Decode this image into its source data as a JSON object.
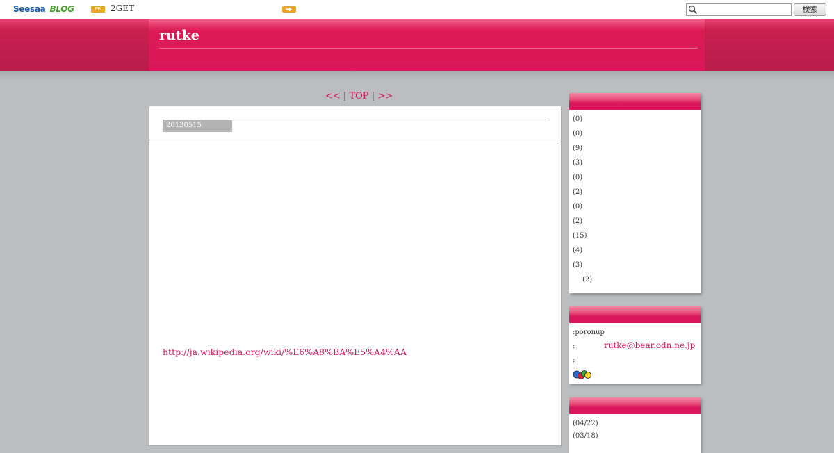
{
  "topbar": {
    "logo_seesaa": "Seesaa",
    "logo_blog": "BLOG",
    "pr_badge": "PR",
    "pr_text": "2GET",
    "search_placeholder": "",
    "search_button": "検索"
  },
  "header": {
    "title": "rutke"
  },
  "nav": {
    "prev": "<<",
    "sep1": " | ",
    "top": "TOP",
    "sep2": " | ",
    "next": ">>"
  },
  "article": {
    "date": "20130515",
    "link": "http://ja.wikipedia.org/wiki/%E6%A8%BA%E5%A4%AA"
  },
  "sidebar": {
    "categories": [
      "(0)",
      "(0)",
      "(9)",
      "(3)",
      "(0)",
      "(2)",
      "(0)",
      "(2)",
      "(15)",
      "(4)",
      "(3)",
      "(2)"
    ],
    "profile": {
      "name": ":poronup",
      "mail_prefix": ":",
      "mail": "rutke@bear.odn.ne.jp",
      "extra_prefix": ":"
    },
    "recent": [
      "(04/22)",
      "(03/18)"
    ]
  },
  "colors": {
    "accent": "#d9175a",
    "link": "#c8195a",
    "page_bg": "#bcbdbf"
  },
  "icons": [
    "search-icon",
    "arrow-right-icon",
    "badge-icon"
  ]
}
